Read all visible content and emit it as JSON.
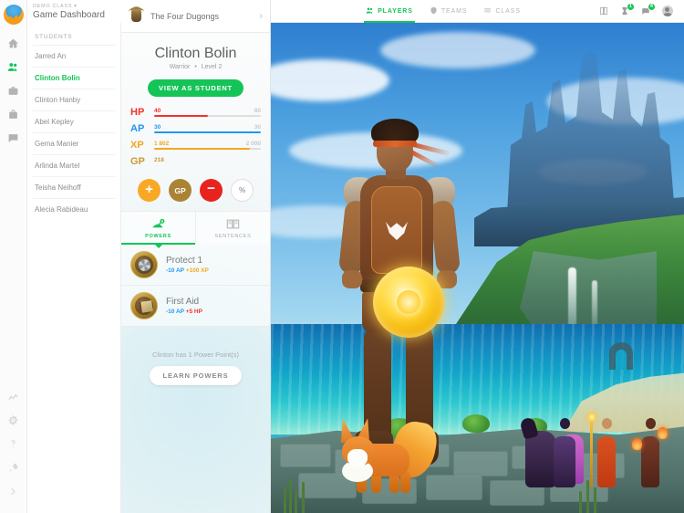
{
  "brand": {
    "logo_icon": "mountain-logo",
    "accent": "#15c457"
  },
  "header": {
    "class_label": "DEMO CLASS",
    "class_caret": "▾",
    "title": "Game Dashboard"
  },
  "rail": {
    "top_items": [
      {
        "name": "home",
        "icon": "home-icon",
        "active": false
      },
      {
        "name": "players",
        "icon": "players-icon",
        "active": true
      },
      {
        "name": "shop",
        "icon": "briefcase-icon",
        "active": false
      },
      {
        "name": "backpack",
        "icon": "bag-icon",
        "active": false
      },
      {
        "name": "messages",
        "icon": "chat-icon",
        "active": false
      }
    ],
    "bottom_items": [
      {
        "name": "analytics",
        "icon": "chart-icon"
      },
      {
        "name": "settings",
        "icon": "gear-icon"
      },
      {
        "name": "help",
        "icon": "question-icon"
      },
      {
        "name": "whats-new",
        "icon": "rocket-icon"
      },
      {
        "name": "expand",
        "icon": "chevron-right-icon"
      }
    ]
  },
  "topnav": {
    "tabs": [
      {
        "label": "PLAYERS",
        "icon": "players-icon",
        "active": true
      },
      {
        "label": "TEAMS",
        "icon": "shield-icon",
        "active": false
      },
      {
        "label": "CLASS",
        "icon": "list-icon",
        "active": false
      }
    ],
    "icons": [
      {
        "name": "book-icon",
        "badge": null
      },
      {
        "name": "hourglass-icon",
        "badge": "1"
      },
      {
        "name": "announcement-icon",
        "badge": "4"
      }
    ],
    "avatar": "teacher-avatar"
  },
  "students_panel": {
    "search_placeholder": "",
    "search_value": "",
    "section_label": "STUDENTS",
    "items": [
      {
        "name": "Jarred An",
        "selected": false
      },
      {
        "name": "Clinton Bolin",
        "selected": true
      },
      {
        "name": "Clinton Hanby",
        "selected": false
      },
      {
        "name": "Abel Kepley",
        "selected": false
      },
      {
        "name": "Gema Manier",
        "selected": false
      },
      {
        "name": "Arlinda Martel",
        "selected": false
      },
      {
        "name": "Teisha Neihoff",
        "selected": false
      },
      {
        "name": "Alecia Rabideau",
        "selected": false
      }
    ]
  },
  "player": {
    "team_name": "The Four Dugongs",
    "team_chevron": "›",
    "name": "Clinton Bolin",
    "class": "Warrior",
    "separator": "•",
    "level": "Level 2",
    "view_as_student": "VIEW AS STUDENT",
    "stats": [
      {
        "key": "HP",
        "current": "40",
        "max": "80",
        "percent": 50,
        "color": "#f0342e"
      },
      {
        "key": "AP",
        "current": "30",
        "max": "30",
        "percent": 100,
        "color": "#2196f3"
      },
      {
        "key": "XP",
        "current": "1 802",
        "max": "2 000",
        "percent": 90,
        "color": "#f5a623"
      },
      {
        "key": "GP",
        "current": "218",
        "max": "",
        "percent": null,
        "color": "#c79b37"
      }
    ],
    "actions": [
      {
        "label": "+",
        "name": "add-points-button",
        "style": "plus"
      },
      {
        "label": "GP",
        "name": "give-gold-button",
        "style": "gp"
      },
      {
        "label": "−",
        "name": "remove-points-button",
        "style": "minus"
      },
      {
        "label": "%",
        "name": "percent-button",
        "style": "pct"
      }
    ],
    "tabs": [
      {
        "label": "POWERS",
        "icon": "powers-icon",
        "active": true
      },
      {
        "label": "SENTENCES",
        "icon": "sentence-icon",
        "active": false
      }
    ],
    "powers": [
      {
        "name": "Protect 1",
        "icon": "shield-power-icon",
        "cost": "-10 AP",
        "reward": "+100 XP",
        "reward_type": "xp"
      },
      {
        "name": "First Aid",
        "icon": "book-power-icon",
        "cost": "-10 AP",
        "reward": "+5 HP",
        "reward_type": "hp"
      }
    ],
    "power_points_note": "Clinton has 1 Power Point(s)",
    "learn_powers": "LEARN POWERS"
  },
  "scene": {
    "description": "Fantasy avatar scene: warrior with golden shield, fox pet, castle on cliffs, sea"
  }
}
